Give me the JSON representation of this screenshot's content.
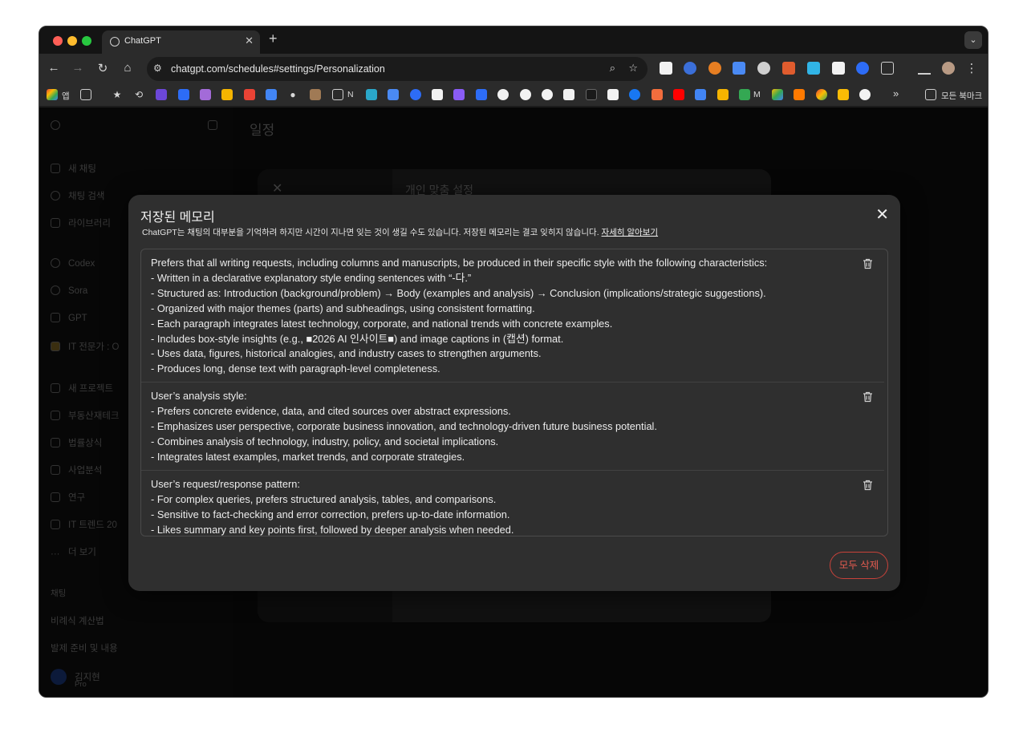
{
  "browser": {
    "tab_title": "ChatGPT",
    "url": "chatgpt.com/schedules#settings/Personalization",
    "bookmarks": {
      "apps_label": "앱",
      "folder_n_label": "N",
      "m_label": "M",
      "overflow_label": "»",
      "all_bookmarks_label": "모든 북마크"
    }
  },
  "background": {
    "page_title": "일정",
    "sidebar": {
      "items": [
        {
          "label": "새 채팅"
        },
        {
          "label": "채팅 검색"
        },
        {
          "label": "라이브러리"
        },
        {
          "label": "Codex"
        },
        {
          "label": "Sora"
        },
        {
          "label": "GPT"
        },
        {
          "label": "IT 전문가 : O"
        },
        {
          "label": "새 프로젝트"
        },
        {
          "label": "부동산재테크"
        },
        {
          "label": "법률상식"
        },
        {
          "label": "사업분석"
        },
        {
          "label": "연구"
        },
        {
          "label": "IT 트렌드 20"
        },
        {
          "label": "더 보기"
        }
      ],
      "section_label": "채팅",
      "chats": [
        {
          "label": "비례식 계산법"
        },
        {
          "label": "발제 준비 및 내용"
        }
      ],
      "user_name": "김지현",
      "user_plan": "Pro"
    },
    "settings_title": "개인 맞춤 설정"
  },
  "modal": {
    "title": "저장된 메모리",
    "description": "ChatGPT는 채팅의 대부분을 기억하려 하지만 시간이 지나면 잊는 것이 생길 수도 있습니다. 저장된 메모리는 결코 잊히지 않습니다.",
    "learn_more": "자세히 알아보기",
    "delete_all_label": "모두 삭제",
    "memories": [
      {
        "lines": [
          "Prefers that all writing requests, including columns and manuscripts, be produced in their specific style with the following characteristics:",
          "- Written in a declarative explanatory style ending sentences with “-다.”",
          "- Structured as: Introduction (background/problem) → Body (examples and analysis) → Conclusion (implications/strategic suggestions).",
          "- Organized with major themes (parts) and subheadings, using consistent formatting.",
          "- Each paragraph integrates latest technology, corporate, and national trends with concrete examples.",
          "- Includes box-style insights (e.g., ■2026 AI 인사이트■) and image captions in (캡션) format.",
          "- Uses data, figures, historical analogies, and industry cases to strengthen arguments.",
          "- Produces long, dense text with paragraph-level completeness."
        ]
      },
      {
        "lines": [
          "User’s analysis style:",
          "- Prefers concrete evidence, data, and cited sources over abstract expressions.",
          "- Emphasizes user perspective, corporate business innovation, and technology-driven future business potential.",
          "- Combines analysis of technology, industry, policy, and societal implications.",
          "- Integrates latest examples, market trends, and corporate strategies."
        ]
      },
      {
        "lines": [
          "User’s request/response pattern:",
          "- For complex queries, prefers structured analysis, tables, and comparisons.",
          "- Sensitive to fact-checking and error correction, prefers up-to-date information.",
          "- Likes summary and key points first, followed by deeper analysis when needed."
        ]
      }
    ]
  }
}
